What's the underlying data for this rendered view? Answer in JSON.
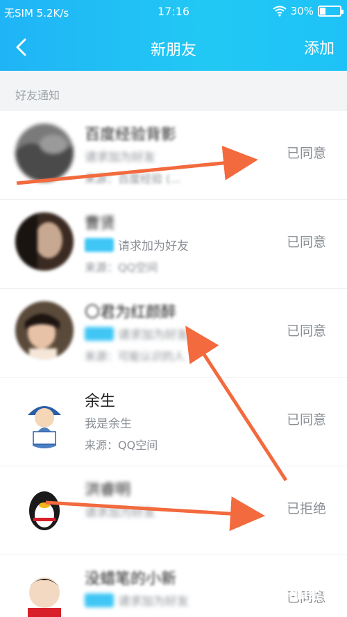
{
  "status_bar": {
    "carrier": "无SIM 5.2K/s",
    "time": "17:16",
    "battery": "30%",
    "battery_level": 0.3
  },
  "header": {
    "back_icon": "chevron-left-icon",
    "title": "新朋友",
    "add_label": "添加"
  },
  "section": {
    "label": "好友通知"
  },
  "items": [
    {
      "name": "百度经验背影",
      "request": "请求加为好友",
      "source": "来源：百度经验 (...",
      "status": "已同意",
      "avatar_color": "#6b6b6b"
    },
    {
      "name": "曹贤",
      "request": "请求加为好友",
      "source": "来源：QQ空间",
      "status": "已同意",
      "avatar_color": "#3a2a22"
    },
    {
      "name": "〇君为红颜醉",
      "request": "请求加为好友",
      "source": "来源：可能认识的人",
      "status": "已同意",
      "avatar_color": "#5a4a3a"
    },
    {
      "name": "余生",
      "request": "我是余生",
      "source": "来源：QQ空间",
      "status": "已同意",
      "avatar_color": "#e8eef2"
    },
    {
      "name": "洪睿明",
      "request": "请求加为好友",
      "source": "",
      "status": "已拒绝",
      "avatar_color": "#ffffff"
    },
    {
      "name": "没蜡笔的小新",
      "request": "请求加为好友",
      "source": "",
      "status": "已同意",
      "avatar_color": "#f3d9c2"
    }
  ],
  "watermark": "Baidu经验",
  "colors": {
    "header": "#1fb4f6",
    "arrow": "#f26a3d",
    "badge": "#3fc6f5"
  }
}
